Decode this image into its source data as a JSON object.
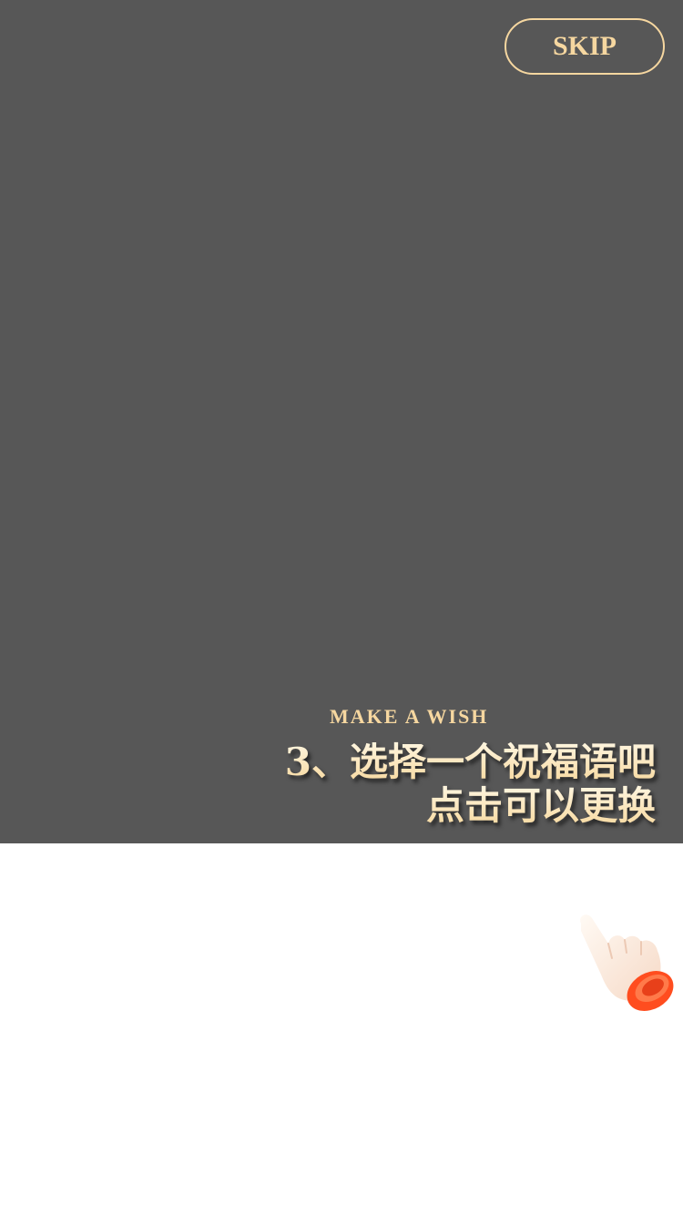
{
  "skip": {
    "label": "SKIP"
  },
  "tip": {
    "subtitle": "MAKE A WISH",
    "line1": "3、选择一个祝福语吧",
    "line2": "点击可以更换"
  },
  "colors": {
    "overlay": "#575757",
    "accent_gold": "#f6d7a0",
    "hand_ring": "#ff5a2a"
  },
  "icons": {
    "hand": "pointing-hand-icon"
  }
}
